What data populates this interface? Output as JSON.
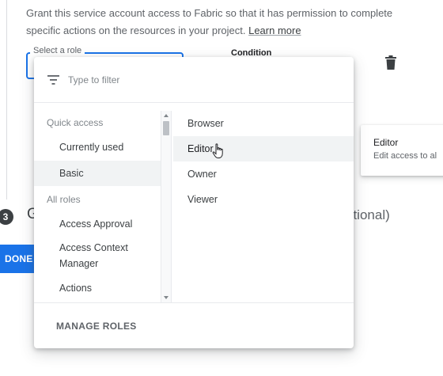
{
  "intro": {
    "text": "Grant this service account access to Fabric so that it has permission to complete specific actions on the resources in your project.",
    "link": "Learn more"
  },
  "role_field": {
    "label": "Select a role"
  },
  "condition": {
    "label": "Condition"
  },
  "role_card": {
    "title": "Editor",
    "description": "Edit access to al"
  },
  "step3": {
    "number": "3",
    "heading_start": "G",
    "heading_end": "otional)"
  },
  "done_button": {
    "label": "DONE"
  },
  "dropdown": {
    "filter_placeholder": "Type to filter",
    "quick_access_heading": "Quick access",
    "quick_access_items": [
      "Currently used",
      "Basic"
    ],
    "all_roles_heading": "All roles",
    "all_roles_items": [
      "Access Approval",
      "Access Context Manager",
      "Actions"
    ],
    "roles": [
      "Browser",
      "Editor",
      "Owner",
      "Viewer"
    ],
    "selected_category": "Basic",
    "hovered_role": "Editor",
    "manage_roles": "MANAGE ROLES"
  },
  "colors": {
    "accent": "#1a73e8",
    "hover_background": "#f1f3f4"
  }
}
